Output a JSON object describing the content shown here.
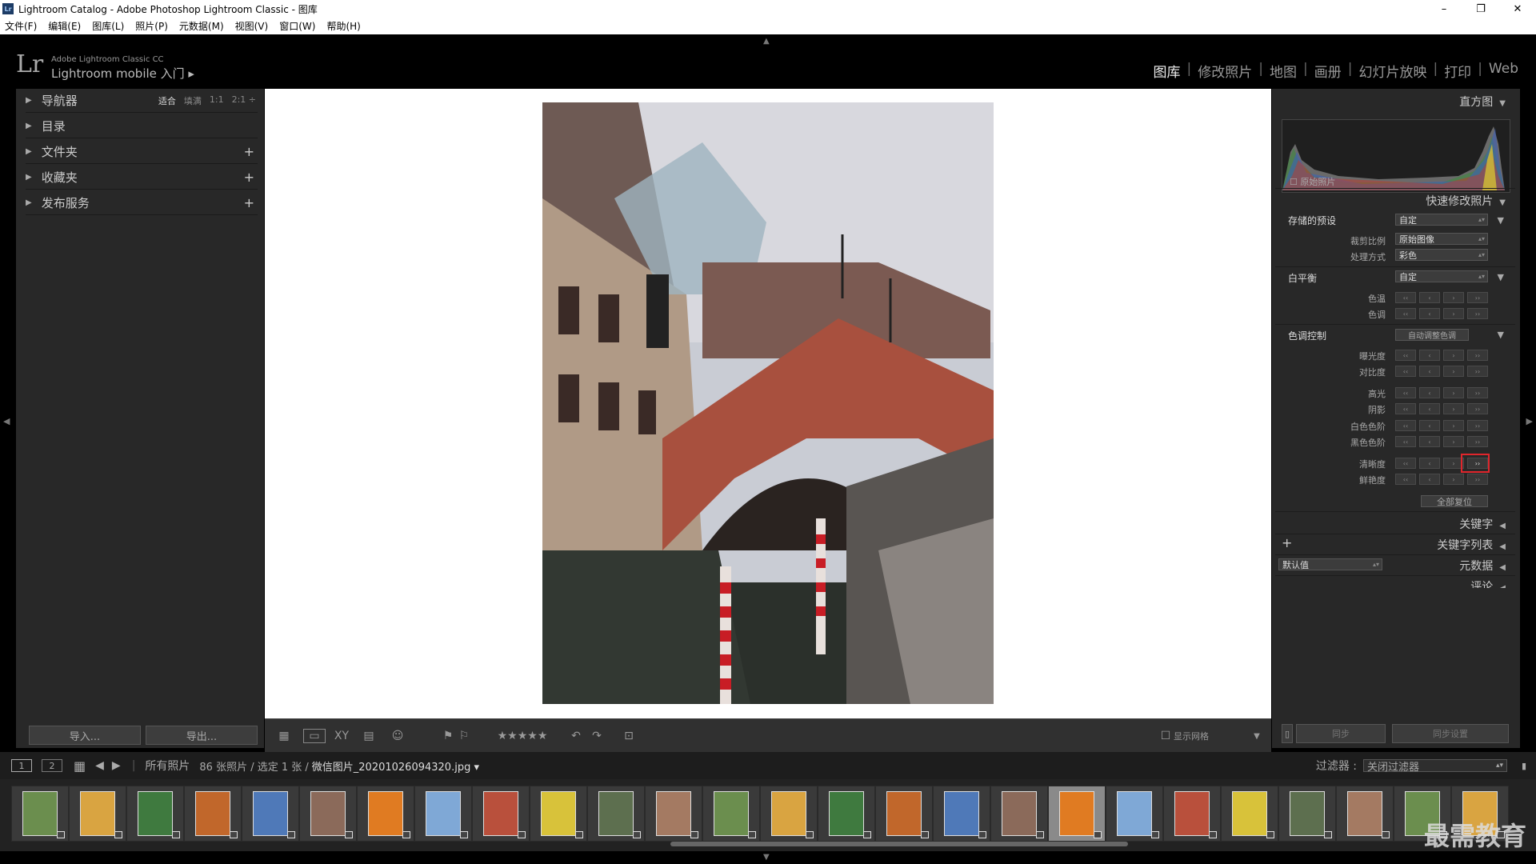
{
  "window": {
    "app_icon": "Lr",
    "title": "Lightroom Catalog - Adobe Photoshop Lightroom Classic - 图库",
    "controls": [
      "–",
      "❐",
      "✕"
    ]
  },
  "menu": [
    "文件(F)",
    "编辑(E)",
    "图库(L)",
    "照片(P)",
    "元数据(M)",
    "视图(V)",
    "窗口(W)",
    "帮助(H)"
  ],
  "identity": {
    "logo": "Lr",
    "product": "Adobe Lightroom Classic CC",
    "mobile": "Lightroom mobile 入门 ▸"
  },
  "modules": [
    "图库",
    "修改照片",
    "地图",
    "画册",
    "幻灯片放映",
    "打印",
    "Web"
  ],
  "active_module": "图库",
  "left_panel": {
    "navigator": {
      "label": "导航器",
      "zoom": [
        "适合",
        "填满",
        "1:1",
        "2:1 ÷"
      ]
    },
    "sections": [
      "目录",
      "文件夹",
      "收藏夹",
      "发布服务"
    ],
    "import_label": "导入...",
    "export_label": "导出..."
  },
  "toolbar": {
    "stars": "★★★★★",
    "show_grid": "显示网格"
  },
  "right_panel": {
    "histogram": {
      "title": "直方图",
      "original_photo": "原始照片"
    },
    "quick_develop": {
      "title": "快速修改照片",
      "saved_preset": {
        "label": "存储的预设",
        "value": "自定"
      },
      "crop_ratio": {
        "label": "裁剪比例",
        "value": "原始图像"
      },
      "treatment": {
        "label": "处理方式",
        "value": "彩色"
      },
      "white_balance": {
        "label": "白平衡",
        "value": "自定"
      },
      "wb_rows": [
        "色温",
        "色调"
      ],
      "tone_control": {
        "label": "色调控制",
        "auto": "自动调整色调"
      },
      "tone_rows_a": [
        "曝光度",
        "对比度"
      ],
      "tone_rows_b": [
        "高光",
        "阴影",
        "白色色阶",
        "黑色色阶"
      ],
      "presence_rows": [
        "清晰度",
        "鲜艳度"
      ],
      "reset_all": "全部复位"
    },
    "keywording": "关键字",
    "keyword_list": "关键字列表",
    "metadata": {
      "title": "元数据",
      "preset": "默认值"
    },
    "comments": "评论",
    "sync": "同步",
    "sync_settings": "同步设置"
  },
  "filmbar": {
    "pages": [
      "1",
      "2"
    ],
    "source": "所有照片",
    "count": "86 张照片 / 选定 1 张 /",
    "filename": "微信图片_20201026094320.jpg ▾",
    "filter_label": "过滤器 :",
    "filter_value": "关闭过滤器"
  },
  "filmstrip_count": 26,
  "selected_thumb": 18,
  "watermark": "最需教育",
  "colors": {
    "accent_box": "#e0262c",
    "panel": "#282828",
    "active_thumb": "#8a8a8a"
  }
}
